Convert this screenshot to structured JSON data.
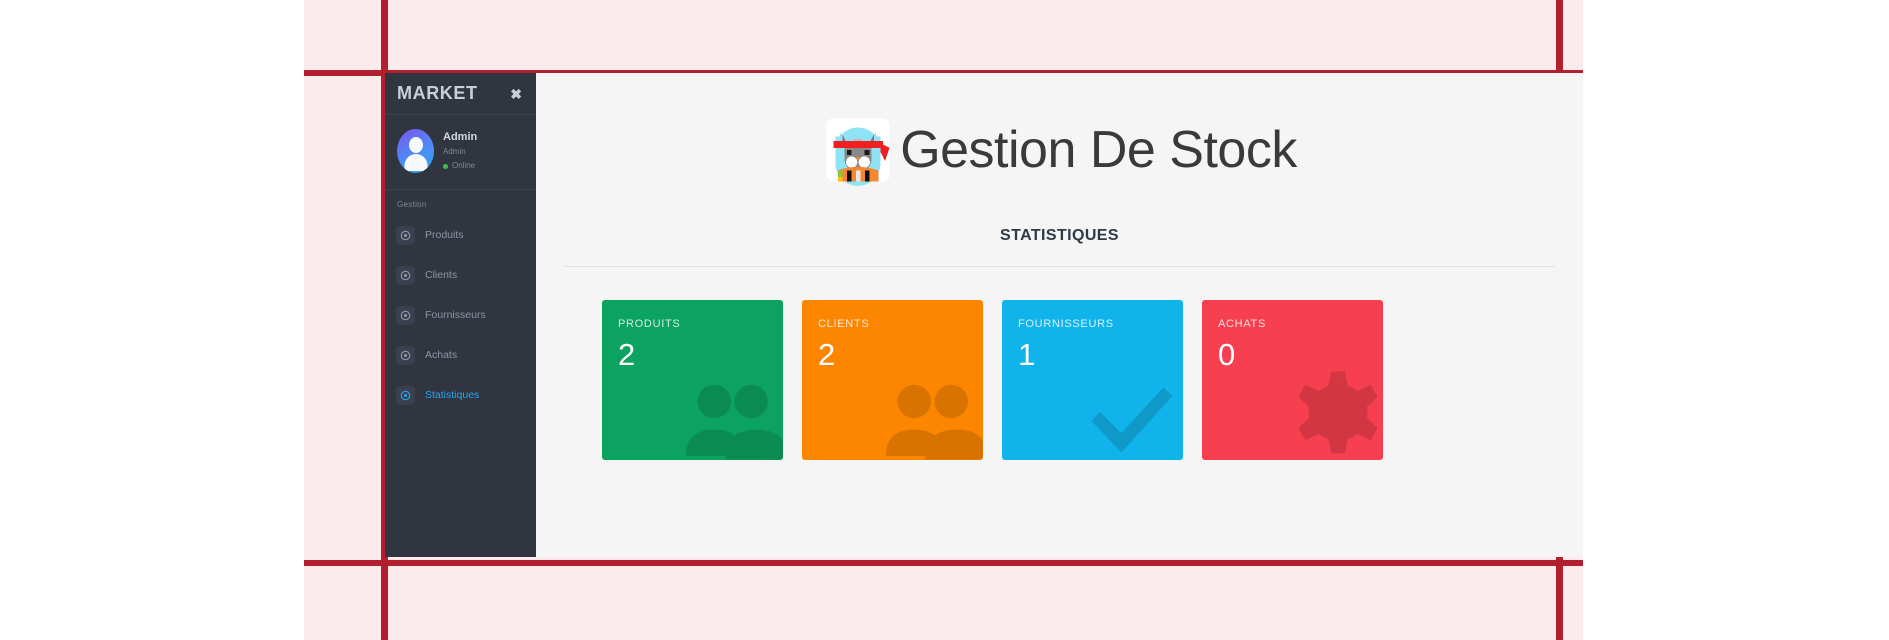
{
  "window": {
    "background_color": "#F5F5F5",
    "guide_color": "#B22030",
    "guide_backdrop_color": "#FCEBEC"
  },
  "sidebar": {
    "brand": "MARKET",
    "close_label": "✖",
    "user": {
      "name": "Admin",
      "role": "Admin",
      "status": "Online",
      "status_color": "#3FBF4E",
      "avatar_icon": "user-avatar"
    },
    "nav_heading": "Gestion",
    "items": [
      {
        "label": "Produits",
        "icon": "circle-dot-icon",
        "active": false
      },
      {
        "label": "Clients",
        "icon": "circle-dot-icon",
        "active": false
      },
      {
        "label": "Fournisseurs",
        "icon": "circle-dot-icon",
        "active": false
      },
      {
        "label": "Achats",
        "icon": "circle-dot-icon",
        "active": false
      },
      {
        "label": "Statistiques",
        "icon": "circle-dot-icon",
        "active": true
      }
    ],
    "active_color": "#22A7F0",
    "background_color": "#31353F"
  },
  "main": {
    "logo_icon": "ninja-cat-logo",
    "title": "Gestion De Stock",
    "subtitle": "STATISTIQUES",
    "cards": [
      {
        "label": "PRODUITS",
        "value": "2",
        "color": "#0CA360",
        "watermark_icon": "people-group-icon"
      },
      {
        "label": "CLIENTS",
        "value": "2",
        "color": "#FC8600",
        "watermark_icon": "people-group-icon"
      },
      {
        "label": "FOURNISSEURS",
        "value": "1",
        "color": "#11B4EA",
        "watermark_icon": "check-mark-icon"
      },
      {
        "label": "ACHATS",
        "value": "0",
        "color": "#F7404F",
        "watermark_icon": "gear-icon"
      }
    ]
  }
}
